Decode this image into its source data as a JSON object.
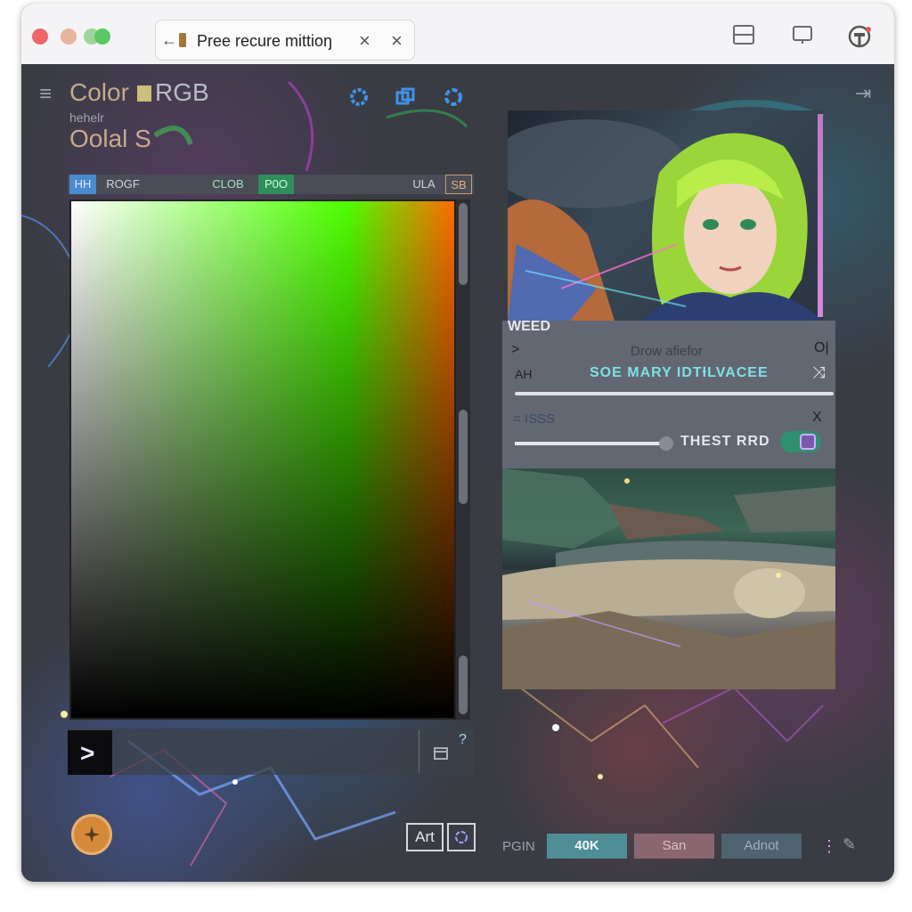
{
  "window": {
    "tab_title": "Pree recure mittioŋ",
    "tab_close_glyph": "×",
    "tab_close2_glyph": "×"
  },
  "toolbar": {
    "layout_icon": "panel-layout-icon",
    "device_icon": "device-icon",
    "profile_icon": "profile-icon"
  },
  "header": {
    "menu_glyph": "≡",
    "title_part1": "Color",
    "title_part2": "RGB",
    "subtitle": "hehelr",
    "sub_title2": "Oolal S",
    "collapse_glyph": "⇥"
  },
  "segments": [
    "HH",
    "ROGF",
    "CLOB",
    "P0O",
    "ULA",
    "SB"
  ],
  "colors": {
    "accent_green": "#3ddc5a",
    "accent_blue": "#4a9cff",
    "toggle": "#2f8f6e"
  },
  "picker": {
    "preview_glyph": ">",
    "help_glyph": "?",
    "copy_icon": "copy-icon"
  },
  "props_panel": {
    "header": "WEED",
    "row1_left": "",
    "row1_center": "Drow afiefor",
    "row1_right": "",
    "row2_left": "AH",
    "row2_center": "SOE MARY IDTƚLVACEE",
    "row3_left": "= ISSS",
    "row3_right": "X",
    "slider_label": "THEST RRD",
    "slider_value": 0.48
  },
  "bottom": {
    "art_label": "Art",
    "prefix_label": "PGIN",
    "btn1": "40K",
    "btn2": "San",
    "btn3": "Adnot"
  }
}
